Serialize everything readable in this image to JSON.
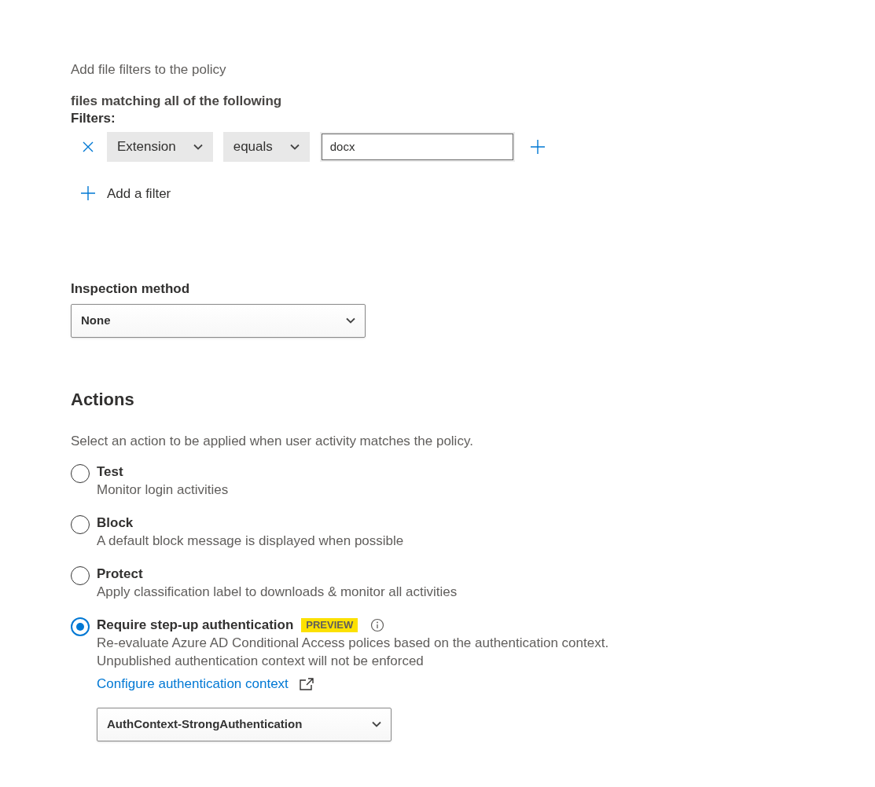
{
  "intro": "Add file filters to the policy",
  "match_label": "files matching all of the following",
  "filters_label": "Filters:",
  "filters": [
    {
      "field": "Extension",
      "operator": "equals",
      "value": "docx"
    }
  ],
  "add_filter": "Add a filter",
  "inspection": {
    "label": "Inspection method",
    "value": "None"
  },
  "actions": {
    "title": "Actions",
    "description": "Select an action to be applied when user activity matches the policy.",
    "options": [
      {
        "label": "Test",
        "description": [
          "Monitor login activities"
        ],
        "selected": false
      },
      {
        "label": "Block",
        "description": [
          "A default block message is displayed when possible"
        ],
        "selected": false
      },
      {
        "label": "Protect",
        "description": [
          "Apply classification label to downloads & monitor all activities"
        ],
        "selected": false
      },
      {
        "label": "Require step-up authentication",
        "badge": "PREVIEW",
        "info": true,
        "description": [
          "Re-evaluate Azure AD Conditional Access polices based on the authentication context.",
          "Unpublished authentication context will not be enforced"
        ],
        "link": "Configure authentication context",
        "dropdown": "AuthContext-StrongAuthentication",
        "selected": true
      }
    ]
  }
}
